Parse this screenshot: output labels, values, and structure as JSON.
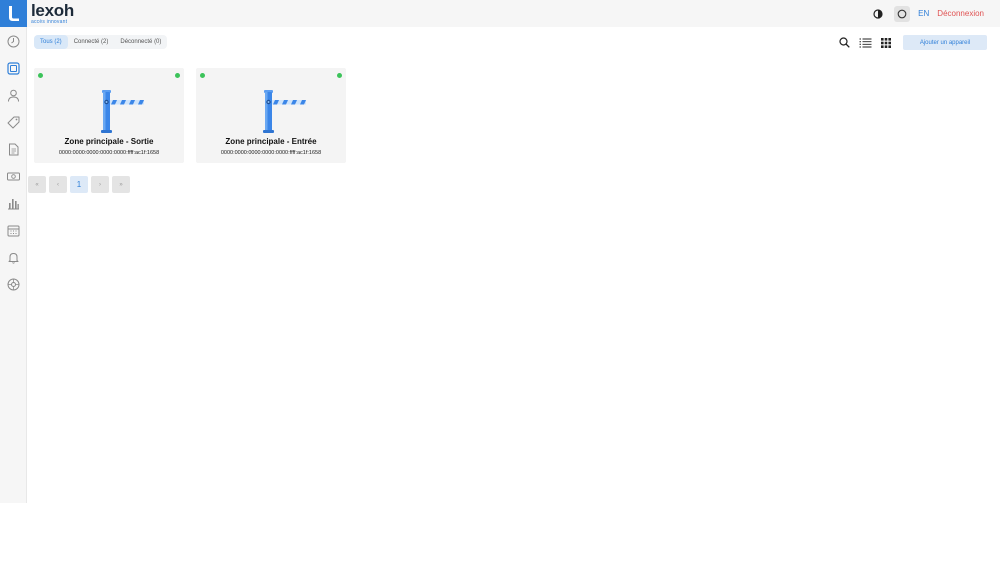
{
  "brand": {
    "name": "lexoh",
    "tagline": "accès innovant"
  },
  "header": {
    "lang": "EN",
    "logout": "Déconnexion"
  },
  "filters": [
    {
      "label": "Tous (2)",
      "active": true
    },
    {
      "label": "Connecté (2)",
      "active": false
    },
    {
      "label": "Déconnecté (0)",
      "active": false
    }
  ],
  "toolbar": {
    "add_label": "Ajouter un appareil"
  },
  "devices": [
    {
      "name": "Zone principale - Sortie",
      "address": "0000:0000:0000:0000:0000:ffff:ac1f:1658",
      "status": "connected"
    },
    {
      "name": "Zone principale - Entrée",
      "address": "0000:0000:0000:0000:0000:ffff:ac1f:1658",
      "status": "connected"
    }
  ],
  "pagination": {
    "first": "«",
    "prev": "‹",
    "current": "1",
    "next": "›",
    "last": "»"
  },
  "colors": {
    "accent": "#2f7fd8",
    "status_online": "#3cc35a",
    "logout": "#e05252"
  }
}
